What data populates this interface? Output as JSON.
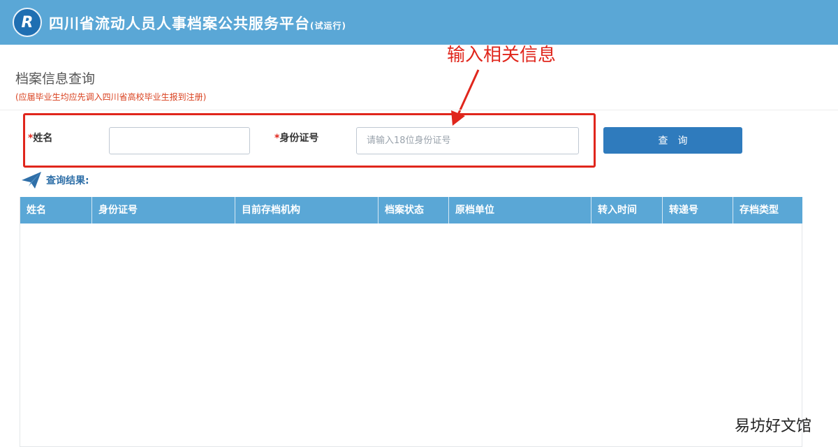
{
  "header": {
    "logo_text": "R",
    "title": "四川省流动人员人事档案公共服务平台",
    "title_suffix": "(试运行)"
  },
  "annotation": {
    "text": "输入相关信息",
    "color": "#e0261c"
  },
  "page": {
    "heading": "档案信息查询",
    "note": "(应届毕业生均应先调入四川省高校毕业生报到注册)"
  },
  "form": {
    "name_label_mark": "*",
    "name_label": "姓名",
    "name_value": "",
    "id_label_mark": "*",
    "id_label": "身份证号",
    "id_placeholder": "请输入18位身份证号",
    "id_value": "",
    "search_button": "查询"
  },
  "results": {
    "icon": "paper-plane-icon",
    "title": "查询结果:",
    "columns": [
      "姓名",
      "身份证号",
      "目前存档机构",
      "档案状态",
      "原档单位",
      "转入时间",
      "转递号",
      "存档类型"
    ],
    "rows": []
  },
  "watermark": "易坊好文馆",
  "colors": {
    "header_bg": "#5aa7d6",
    "button_bg": "#2f7bbd",
    "accent_red": "#e0261c"
  }
}
